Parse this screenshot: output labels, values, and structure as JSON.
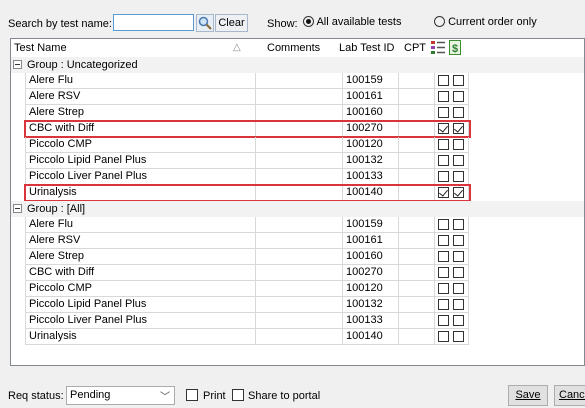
{
  "toolbar": {
    "search_label": "Search by test name:",
    "search_value": "",
    "clear_label": "Clear",
    "show_label": "Show:",
    "radio_all_label": "All available tests",
    "radio_current_label": "Current order only",
    "selected_filter": "all"
  },
  "grid": {
    "columns": {
      "name": "Test Name",
      "comments": "Comments",
      "lab_id": "Lab Test ID",
      "cpt": "CPT"
    },
    "header_icons": [
      "list-check-icon",
      "dollar-icon"
    ],
    "groups": [
      {
        "label": "Group : Uncategorized",
        "rows": [
          {
            "name": "Alere Flu",
            "lab_id": "100159",
            "c1": false,
            "c2": false,
            "highlighted": false
          },
          {
            "name": "Alere RSV",
            "lab_id": "100161",
            "c1": false,
            "c2": false,
            "highlighted": false
          },
          {
            "name": "Alere Strep",
            "lab_id": "100160",
            "c1": false,
            "c2": false,
            "highlighted": false
          },
          {
            "name": "CBC with Diff",
            "lab_id": "100270",
            "c1": true,
            "c2": true,
            "highlighted": true
          },
          {
            "name": "Piccolo CMP",
            "lab_id": "100120",
            "c1": false,
            "c2": false,
            "highlighted": false
          },
          {
            "name": "Piccolo Lipid Panel Plus",
            "lab_id": "100132",
            "c1": false,
            "c2": false,
            "highlighted": false
          },
          {
            "name": "Piccolo Liver Panel Plus",
            "lab_id": "100133",
            "c1": false,
            "c2": false,
            "highlighted": false
          },
          {
            "name": "Urinalysis",
            "lab_id": "100140",
            "c1": true,
            "c2": true,
            "highlighted": true
          }
        ]
      },
      {
        "label": "Group : [All]",
        "rows": [
          {
            "name": "Alere Flu",
            "lab_id": "100159",
            "c1": false,
            "c2": false,
            "highlighted": false
          },
          {
            "name": "Alere RSV",
            "lab_id": "100161",
            "c1": false,
            "c2": false,
            "highlighted": false
          },
          {
            "name": "Alere Strep",
            "lab_id": "100160",
            "c1": false,
            "c2": false,
            "highlighted": false
          },
          {
            "name": "CBC with Diff",
            "lab_id": "100270",
            "c1": false,
            "c2": false,
            "highlighted": false
          },
          {
            "name": "Piccolo CMP",
            "lab_id": "100120",
            "c1": false,
            "c2": false,
            "highlighted": false
          },
          {
            "name": "Piccolo Lipid Panel Plus",
            "lab_id": "100132",
            "c1": false,
            "c2": false,
            "highlighted": false
          },
          {
            "name": "Piccolo Liver Panel Plus",
            "lab_id": "100133",
            "c1": false,
            "c2": false,
            "highlighted": false
          },
          {
            "name": "Urinalysis",
            "lab_id": "100140",
            "c1": false,
            "c2": false,
            "highlighted": false
          }
        ]
      }
    ],
    "highlight_color": "#d9353a"
  },
  "footer": {
    "req_status_label": "Req status:",
    "req_status_value": "Pending",
    "print_label": "Print",
    "print_checked": false,
    "share_label": "Share to portal",
    "share_checked": false,
    "save_label": "Save",
    "cancel_label": "Cancel"
  }
}
